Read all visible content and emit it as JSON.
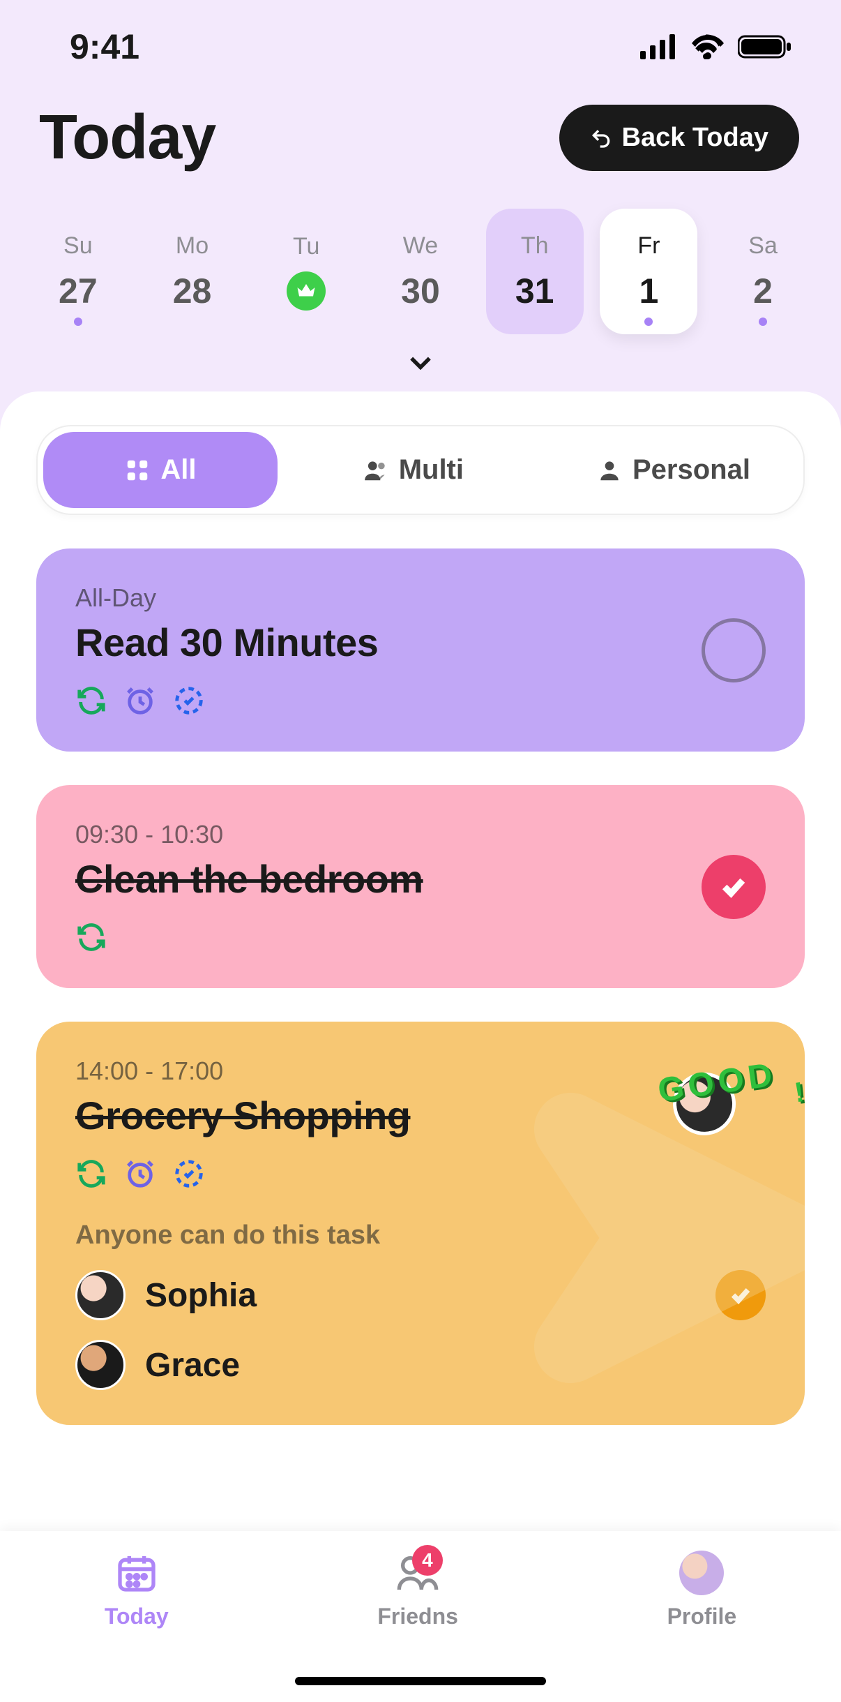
{
  "status": {
    "time": "9:41"
  },
  "header": {
    "title": "Today",
    "back_button": "Back Today"
  },
  "week": {
    "days": [
      {
        "name": "Su",
        "num": "27",
        "has_dot": true
      },
      {
        "name": "Mo",
        "num": "28"
      },
      {
        "name": "Tu",
        "badge": true
      },
      {
        "name": "We",
        "num": "30"
      },
      {
        "name": "Th",
        "num": "31",
        "highlight": true
      },
      {
        "name": "Fr",
        "num": "1",
        "selected": true,
        "has_dot": true
      },
      {
        "name": "Sa",
        "num": "2",
        "has_dot": true
      }
    ]
  },
  "filters": {
    "all": "All",
    "multi": "Multi",
    "personal": "Personal"
  },
  "tasks": [
    {
      "time_label": "All-Day",
      "title": "Read 30 Minutes",
      "icons": [
        "repeat",
        "alarm",
        "progress"
      ],
      "color": "purple",
      "completed": false
    },
    {
      "time_label": "09:30 - 10:30",
      "title": "Clean the bedroom",
      "icons": [
        "repeat"
      ],
      "color": "pink",
      "completed": true
    },
    {
      "time_label": "14:00 - 17:00",
      "title": "Grocery Shopping",
      "icons": [
        "repeat",
        "alarm",
        "progress"
      ],
      "color": "yellow",
      "completed": true,
      "note": "Anyone can do this task",
      "good_badge": "GOOD",
      "participants": [
        {
          "name": "Sophia",
          "checked": true
        },
        {
          "name": "Grace",
          "checked": false
        }
      ]
    }
  ],
  "nav": {
    "today": "Today",
    "friends": "Friedns",
    "friends_badge": "4",
    "profile": "Profile"
  }
}
